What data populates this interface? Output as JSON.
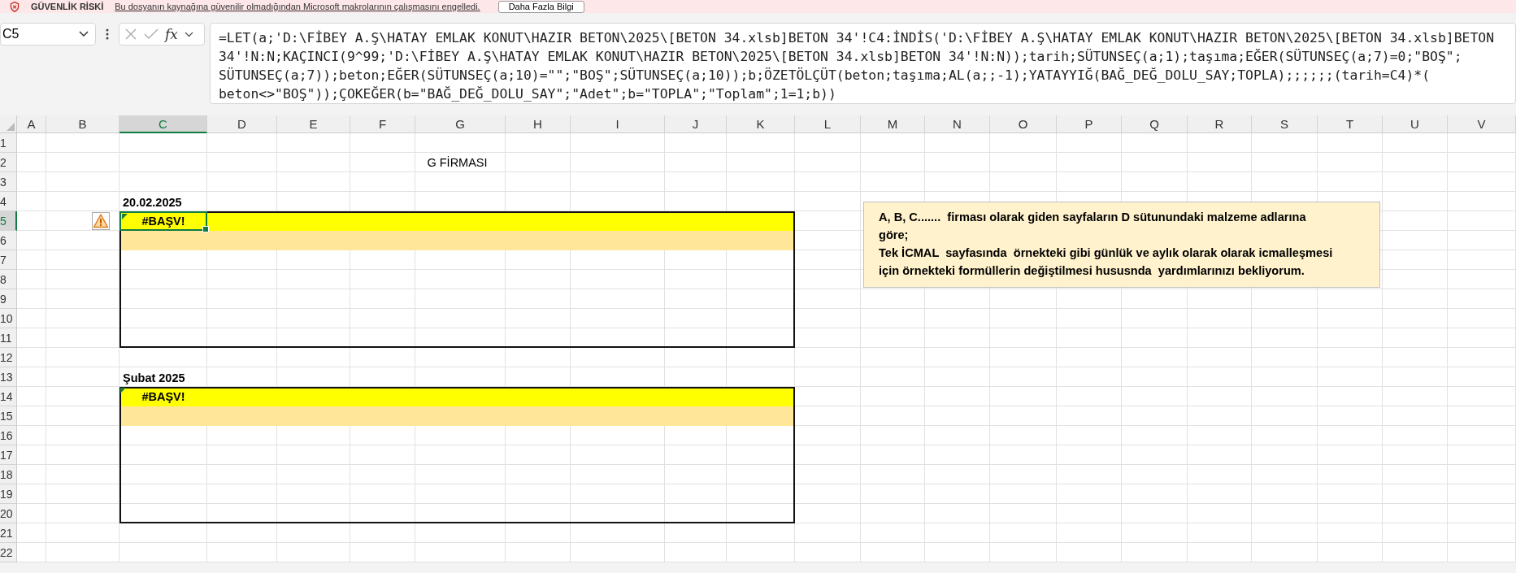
{
  "security_bar": {
    "title": "GÜVENLİK RİSKİ",
    "message": "Bu dosyanın kaynağına güvenilir olmadığından Microsoft makrolarının çalışmasını engelledi.",
    "button": "Daha Fazla Bilgi"
  },
  "formula_bar": {
    "name_box": "C5",
    "function_button": "fx",
    "formula_lines": [
      "=LET(a;'D:\\FİBEY A.Ş\\HATAY EMLAK KONUT\\HAZIR BETON\\2025\\[BETON 34.xlsb]BETON 34'!C4:İNDİS('D:\\FİBEY A.Ş\\HATAY EMLAK KONUT\\HAZIR BETON\\2025\\[BETON 34.xlsb]BETON",
      "34'!N:N;KAÇINCI(9^99;'D:\\FİBEY A.Ş\\HATAY EMLAK KONUT\\HAZIR BETON\\2025\\[BETON 34.xlsb]BETON 34'!N:N));tarih;SÜTUNSEÇ(a;1);taşıma;EĞER(SÜTUNSEÇ(a;7)=0;\"BOŞ\";",
      "SÜTUNSEÇ(a;7));beton;EĞER(SÜTUNSEÇ(a;10)=\"\";\"BOŞ\";SÜTUNSEÇ(a;10));b;ÖZETÖLÇÜT(beton;taşıma;AL(a;;-1);YATAYYIĞ(BAĞ_DEĞ_DOLU_SAY;TOPLA);;;;;;(tarih=C4)*(",
      "beton<>\"BOŞ\"));ÇOKEĞER(b=\"BAĞ_DEĞ_DOLU_SAY\";\"Adet\";b=\"TOPLA\";\"Toplam\";1=1;b))"
    ]
  },
  "columns": [
    {
      "label": "A",
      "selected": false
    },
    {
      "label": "B",
      "selected": false
    },
    {
      "label": "C",
      "selected": true
    },
    {
      "label": "D",
      "selected": false
    },
    {
      "label": "E",
      "selected": false
    },
    {
      "label": "F",
      "selected": false
    },
    {
      "label": "G",
      "selected": false
    },
    {
      "label": "H",
      "selected": false
    },
    {
      "label": "I",
      "selected": false
    },
    {
      "label": "J",
      "selected": false
    },
    {
      "label": "K",
      "selected": false
    },
    {
      "label": "L",
      "selected": false
    },
    {
      "label": "M",
      "selected": false
    },
    {
      "label": "N",
      "selected": false
    },
    {
      "label": "O",
      "selected": false
    },
    {
      "label": "P",
      "selected": false
    },
    {
      "label": "Q",
      "selected": false
    },
    {
      "label": "R",
      "selected": false
    },
    {
      "label": "S",
      "selected": false
    },
    {
      "label": "T",
      "selected": false
    },
    {
      "label": "U",
      "selected": false
    },
    {
      "label": "V",
      "selected": false
    }
  ],
  "rows": [
    {
      "label": "1",
      "selected": false
    },
    {
      "label": "2",
      "selected": false
    },
    {
      "label": "3",
      "selected": false
    },
    {
      "label": "4",
      "selected": false
    },
    {
      "label": "5",
      "selected": true
    },
    {
      "label": "6",
      "selected": false
    },
    {
      "label": "7",
      "selected": false
    },
    {
      "label": "8",
      "selected": false
    },
    {
      "label": "9",
      "selected": false
    },
    {
      "label": "10",
      "selected": false
    },
    {
      "label": "11",
      "selected": false
    },
    {
      "label": "12",
      "selected": false
    },
    {
      "label": "13",
      "selected": false
    },
    {
      "label": "14",
      "selected": false
    },
    {
      "label": "15",
      "selected": false
    },
    {
      "label": "16",
      "selected": false
    },
    {
      "label": "17",
      "selected": false
    },
    {
      "label": "18",
      "selected": false
    },
    {
      "label": "19",
      "selected": false
    },
    {
      "label": "20",
      "selected": false
    },
    {
      "label": "21",
      "selected": false
    },
    {
      "label": "22",
      "selected": false
    }
  ],
  "sheet_title": "G FİRMASI",
  "blocks": [
    {
      "heading": "20.02.2025",
      "value": "#BAŞV!",
      "selected": true,
      "warning": true
    },
    {
      "heading": "Şubat 2025",
      "value": "#BAŞV!",
      "selected": false,
      "warning": false
    }
  ],
  "note": [
    "A, B, C.......  firması olarak giden sayfaların D sütunundaki malzeme adlarına göre;",
    "Tek İCMAL  sayfasında  örnekteki gibi günlük ve aylık olarak olarak icmalleşmesi için örnekteki formüllerin değiştilmesi hususnda  yardımlarınızı bekliyorum."
  ]
}
